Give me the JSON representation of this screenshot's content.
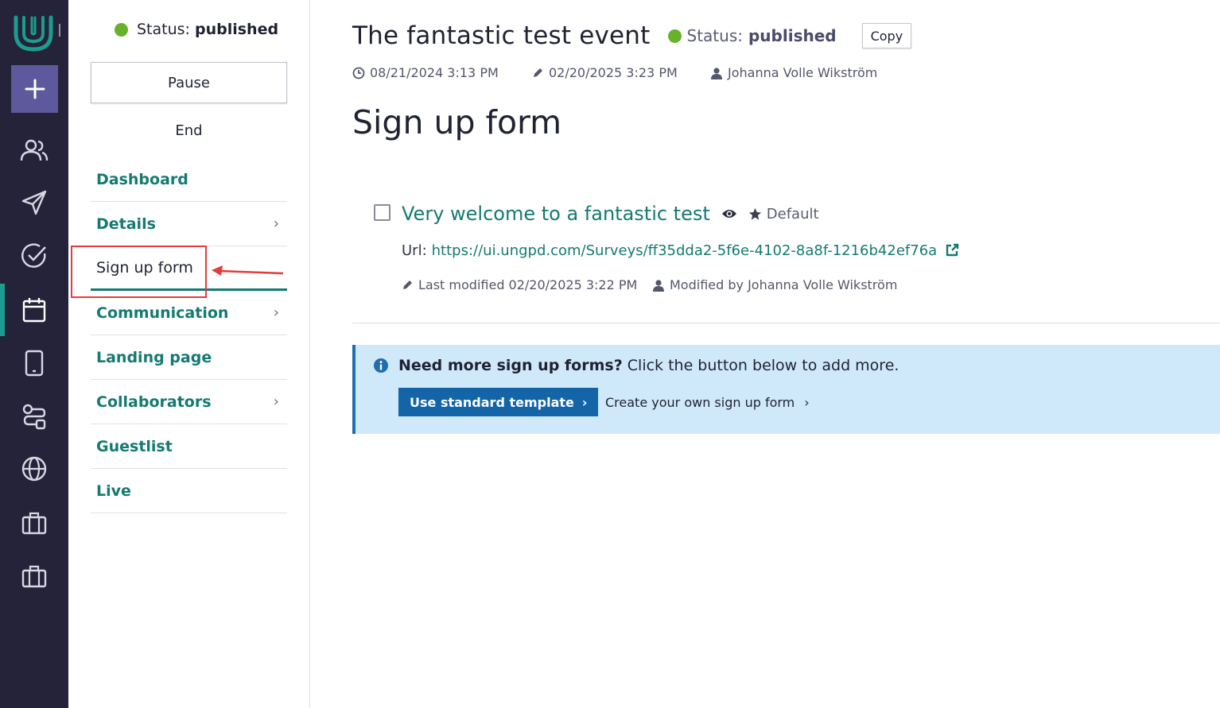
{
  "sidebar_status": {
    "label": "Status:",
    "value": "published"
  },
  "actions": {
    "pause": "Pause",
    "end": "End"
  },
  "nav": {
    "items": [
      {
        "label": "Dashboard"
      },
      {
        "label": "Details"
      },
      {
        "label": "Sign up form"
      },
      {
        "label": "Communication"
      },
      {
        "label": "Landing page"
      },
      {
        "label": "Collaborators"
      },
      {
        "label": "Guestlist"
      },
      {
        "label": "Live"
      }
    ]
  },
  "rail": {
    "icons": [
      "logo-icon",
      "plus-icon",
      "people-icon",
      "send-icon",
      "check-circle-icon",
      "calendar-icon",
      "mobile-icon",
      "workflow-icon",
      "globe-icon",
      "briefcase-icon",
      "briefcase-icon"
    ]
  },
  "event": {
    "title": "The fantastic test event",
    "status_label": "Status:",
    "status_value": "published",
    "copy": "Copy",
    "created": "08/21/2024 3:13 PM",
    "edited": "02/20/2025 3:23 PM",
    "author": "Johanna Volle Wikström"
  },
  "page": {
    "title": "Sign up form"
  },
  "form": {
    "title": "Very welcome to a fantastic test",
    "default_label": "Default",
    "url_label": "Url:",
    "url": "https://ui.ungpd.com/Surveys/ff35dda2-5f6e-4102-8a8f-1216b42ef76a",
    "last_modified": "Last modified 02/20/2025 3:22 PM",
    "modified_by": "Modified by Johanna Volle Wikström"
  },
  "info": {
    "bold": "Need more sign up forms?",
    "text": " Click the button below to add more.",
    "primary_button": "Use standard template",
    "secondary_button": "Create your own sign up form"
  },
  "colors": {
    "rail_bg": "#24233a",
    "accent_purple": "#5e589c",
    "teal": "#147a72",
    "status_green": "#66b22a",
    "info_bg": "#cfe9fb",
    "primary_blue": "#1465a8",
    "annotation_red": "#e23c3c"
  }
}
